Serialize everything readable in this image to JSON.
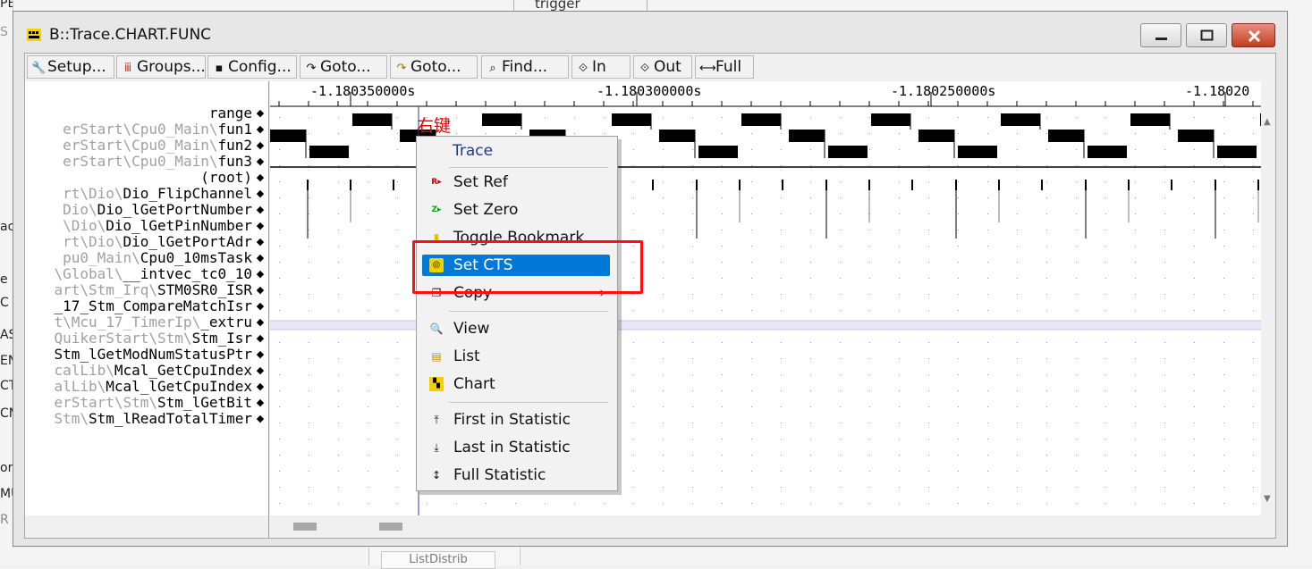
{
  "window": {
    "title": "B::Trace.CHART.FUNC",
    "controls": [
      "minimize",
      "maximize",
      "close"
    ]
  },
  "background": {
    "group_label": "trigger",
    "bottom_button": "ListDistrib",
    "left_letters": [
      "PE",
      "S",
      "ac",
      "e",
      "C",
      "AS",
      "EN",
      "CT",
      "CM",
      "or",
      "MU",
      "R"
    ]
  },
  "toolbar": [
    {
      "label": "Setup...",
      "icon": "wrench-icon"
    },
    {
      "label": "Groups...",
      "icon": "groups-icon"
    },
    {
      "label": "Config...",
      "icon": "config-icon"
    },
    {
      "label": "Goto...",
      "icon": "goto-icon"
    },
    {
      "label": "Goto...",
      "icon": "goto-icon"
    },
    {
      "label": "Find...",
      "icon": "find-icon"
    },
    {
      "label": "In",
      "icon": "zoom-in-icon"
    },
    {
      "label": "Out",
      "icon": "zoom-out-icon"
    },
    {
      "label": "Full",
      "icon": "zoom-full-icon"
    }
  ],
  "timeline": {
    "range_label": "range",
    "ticks": [
      "-1.180350000s",
      "-1.180300000s",
      "-1.180250000s",
      "-1.18020"
    ]
  },
  "functions": [
    {
      "prefix": "erStart\\Cpu0_Main\\",
      "name": "fun1"
    },
    {
      "prefix": "erStart\\Cpu0_Main\\",
      "name": "fun2"
    },
    {
      "prefix": "erStart\\Cpu0_Main\\",
      "name": "fun3"
    },
    {
      "prefix": "",
      "name": "(root)"
    },
    {
      "prefix": "rt\\Dio\\",
      "name": "Dio_FlipChannel"
    },
    {
      "prefix": "Dio\\",
      "name": "Dio_lGetPortNumber"
    },
    {
      "prefix": "\\Dio\\",
      "name": "Dio_lGetPinNumber"
    },
    {
      "prefix": "rt\\Dio\\",
      "name": "Dio_lGetPortAdr"
    },
    {
      "prefix": "pu0_Main\\",
      "name": "Cpu0_10msTask"
    },
    {
      "prefix": "\\Global\\",
      "name": "__intvec_tc0_10"
    },
    {
      "prefix": "art\\Stm_Irq\\",
      "name": "STM0SR0_ISR"
    },
    {
      "prefix": "",
      "name": "_17_Stm_CompareMatchIsr"
    },
    {
      "prefix": "t\\Mcu_17_TimerIp\\",
      "name": "_extru"
    },
    {
      "prefix": "QuikerStart\\Stm\\",
      "name": "Stm_Isr"
    },
    {
      "prefix": "",
      "name": "Stm_lGetModNumStatusPtr"
    },
    {
      "prefix": "calLib\\",
      "name": "Mcal_GetCpuIndex"
    },
    {
      "prefix": "alLib\\",
      "name": "Mcal_lGetCpuIndex"
    },
    {
      "prefix": "erStart\\Stm\\",
      "name": "Stm_lGetBit"
    },
    {
      "prefix": "Stm\\",
      "name": "Stm_lReadTotalTimer"
    }
  ],
  "annotation": {
    "text": "右键"
  },
  "context_menu": {
    "header": "Trace",
    "items": [
      {
        "label": "Set Ref",
        "icon": "set-ref-icon"
      },
      {
        "label": "Set Zero",
        "icon": "set-zero-icon"
      },
      {
        "label": "Toggle Bookmark",
        "icon": "bookmark-icon"
      },
      {
        "label": "Set CTS",
        "icon": "cts-icon",
        "selected": true
      },
      {
        "label": "Copy",
        "icon": "copy-icon",
        "submenu": true
      },
      {
        "label": "View",
        "icon": "magnifier-icon"
      },
      {
        "label": "List",
        "icon": "list-icon"
      },
      {
        "label": "Chart",
        "icon": "chart-icon"
      },
      {
        "label": "First in Statistic",
        "icon": "first-icon"
      },
      {
        "label": "Last in Statistic",
        "icon": "last-icon"
      },
      {
        "label": "Full Statistic",
        "icon": "full-statistic-icon"
      }
    ]
  },
  "colors": {
    "highlight": "#0078d7",
    "annotation": "#ff0000",
    "menu_header": "#1f3a90"
  }
}
